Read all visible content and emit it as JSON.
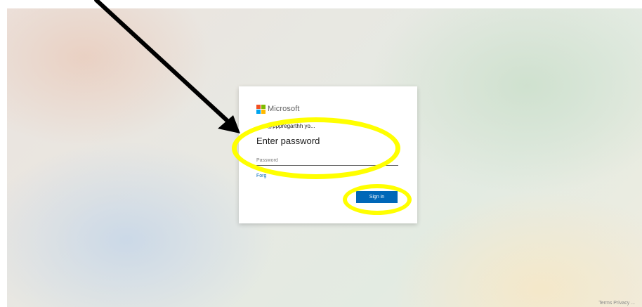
{
  "brand": {
    "name": "Microsoft",
    "logo_colors": [
      "#f25022",
      "#7fba00",
      "#00a4ef",
      "#ffb900"
    ]
  },
  "identity": {
    "back_icon": "left-arrow-icon",
    "email": "@pppregarthh yo..."
  },
  "heading": "Enter password",
  "password_field": {
    "placeholder": "Password",
    "value": ""
  },
  "forgot_link": "Forg",
  "signin_button": "Sign in",
  "footer": "Terms  Privacy  ...",
  "colors": {
    "accent": "#0067b8",
    "annotation": "#ffff00",
    "arrow": "#000000"
  }
}
